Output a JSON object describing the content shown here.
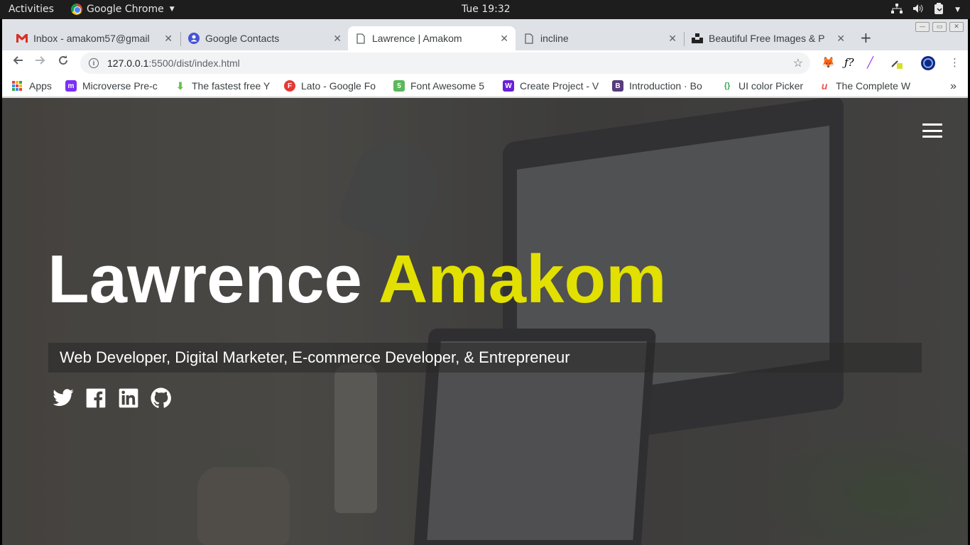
{
  "os_bar": {
    "activities": "Activities",
    "app_name": "Google Chrome",
    "clock": "Tue 19:32"
  },
  "tabs": [
    {
      "title": "Inbox - amakom57@gmail",
      "icon": "gmail-icon"
    },
    {
      "title": "Google Contacts",
      "icon": "contacts-icon"
    },
    {
      "title": "Lawrence | Amakom",
      "icon": "page-icon",
      "active": true
    },
    {
      "title": "incline",
      "icon": "page-icon"
    },
    {
      "title": "Beautiful Free Images & P",
      "icon": "unsplash-icon"
    }
  ],
  "address_bar": {
    "host": "127.0.0.1",
    "path": ":5500/dist/index.html"
  },
  "bookmarks": [
    {
      "label": "Apps",
      "icon": "apps-grid-icon"
    },
    {
      "label": "Microverse Pre-c",
      "icon": "microverse-icon",
      "color": "#7b2ff7",
      "glyph": "m"
    },
    {
      "label": "The fastest free Y",
      "icon": "download-icon",
      "color": "#6cc04a",
      "glyph": "⬇"
    },
    {
      "label": "Lato - Google Fo",
      "icon": "google-fonts-icon",
      "color": "#e53935",
      "glyph": "F"
    },
    {
      "label": "Font Awesome 5",
      "icon": "font-awesome-icon",
      "color": "#5cb85c",
      "glyph": "5"
    },
    {
      "label": "Create Project - V",
      "icon": "webflow-icon",
      "color": "#6a1fd8",
      "glyph": "W"
    },
    {
      "label": "Introduction · Bo",
      "icon": "bootstrap-icon",
      "color": "#563d7c",
      "glyph": "B"
    },
    {
      "label": "UI color Picker",
      "icon": "color-picker-icon",
      "color": "#ffffff",
      "glyph": "{}"
    },
    {
      "label": "The Complete W",
      "icon": "udemy-icon",
      "color": "#ffffff",
      "glyph": "u"
    }
  ],
  "hero": {
    "first_name": "Lawrence",
    "last_name": "Amakom",
    "tagline": "Web Developer, Digital Marketer, E-commerce Developer, & Entrepreneur",
    "accent_color": "#e2e000"
  },
  "socials": [
    "twitter-icon",
    "facebook-icon",
    "linkedin-icon",
    "github-icon"
  ]
}
